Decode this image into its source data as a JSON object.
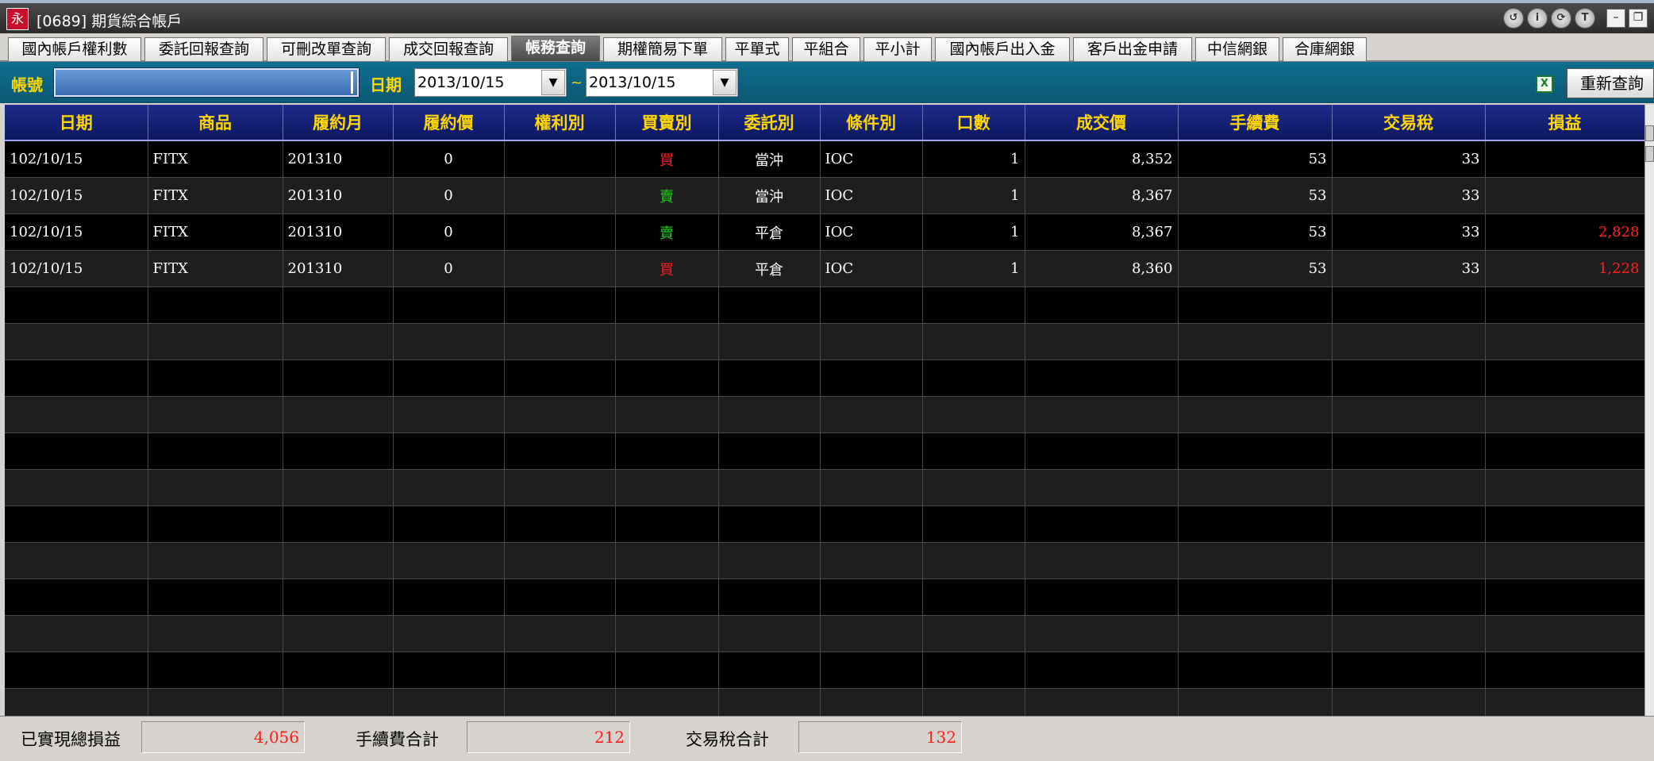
{
  "window": {
    "title": "[0689] 期貨綜合帳戶",
    "icon_text": "永"
  },
  "title_buttons": [
    "↺",
    "i",
    "⟳",
    "T"
  ],
  "tabs": [
    {
      "label": "國內帳戶權利數",
      "active": false
    },
    {
      "label": "委託回報查詢",
      "active": false
    },
    {
      "label": "可刪改單查詢",
      "active": false
    },
    {
      "label": "成交回報查詢",
      "active": false
    },
    {
      "label": "帳務查詢",
      "active": true
    },
    {
      "label": "期權簡易下單",
      "active": false
    },
    {
      "label": "平單式",
      "active": false
    },
    {
      "label": "平組合",
      "active": false
    },
    {
      "label": "平小計",
      "active": false
    },
    {
      "label": "國內帳戶出入金",
      "active": false
    },
    {
      "label": "客戶出金申請",
      "active": false
    },
    {
      "label": "中信網銀",
      "active": false
    },
    {
      "label": "合庫網銀",
      "active": false
    }
  ],
  "query": {
    "account_label": "帳號",
    "account_value": "",
    "date_label": "日期",
    "date_from": "2013/10/15",
    "separator": "~",
    "date_to": "2013/10/15",
    "requery_label": "重新查詢"
  },
  "table": {
    "columns": [
      "日期",
      "商品",
      "履約月",
      "履約價",
      "權利別",
      "買賣別",
      "委託別",
      "條件別",
      "口數",
      "成交價",
      "手續費",
      "交易稅",
      "損益"
    ],
    "rows": [
      [
        "102/10/15",
        "FITX",
        "201310",
        "0",
        "",
        "買",
        "當沖",
        "IOC",
        "1",
        "8,352",
        "53",
        "33",
        ""
      ],
      [
        "102/10/15",
        "FITX",
        "201310",
        "0",
        "",
        "賣",
        "當沖",
        "IOC",
        "1",
        "8,367",
        "53",
        "33",
        ""
      ],
      [
        "102/10/15",
        "FITX",
        "201310",
        "0",
        "",
        "賣",
        "平倉",
        "IOC",
        "1",
        "8,367",
        "53",
        "33",
        "2,828"
      ],
      [
        "102/10/15",
        "FITX",
        "201310",
        "0",
        "",
        "買",
        "平倉",
        "IOC",
        "1",
        "8,360",
        "53",
        "33",
        "1,228"
      ]
    ]
  },
  "footer": {
    "realized_label": "已實現總損益",
    "realized_value": "4,056",
    "fee_label": "手續費合計",
    "fee_value": "212",
    "tax_label": "交易稅合計",
    "tax_value": "132"
  },
  "colors": {
    "buy": "#ff2020",
    "sell": "#22cc22",
    "header_text": "#ffd700",
    "header_bg": "#0c1760"
  }
}
